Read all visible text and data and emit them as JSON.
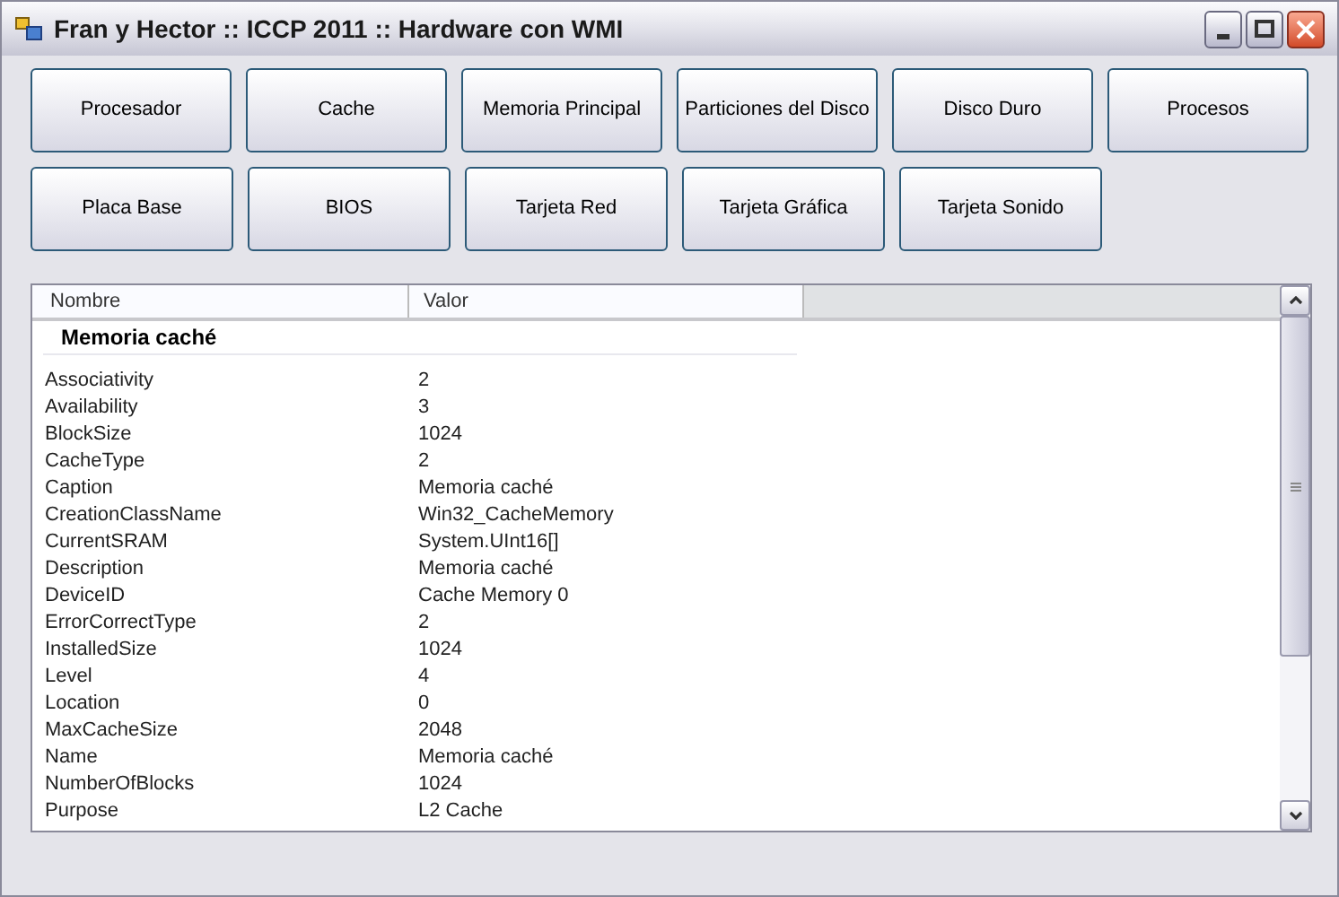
{
  "window": {
    "title": "Fran y Hector :: ICCP 2011 :: Hardware con WMI"
  },
  "button_rows": [
    [
      "Procesador",
      "Cache",
      "Memoria Principal",
      "Particiones del Disco",
      "Disco Duro",
      "Procesos"
    ],
    [
      "Placa Base",
      "BIOS",
      "Tarjeta Red",
      "Tarjeta Gráfica",
      "Tarjeta Sonido"
    ]
  ],
  "list": {
    "columns": [
      "Nombre",
      "Valor"
    ],
    "group": "Memoria caché",
    "rows": [
      {
        "name": "Associativity",
        "value": "2"
      },
      {
        "name": "Availability",
        "value": "3"
      },
      {
        "name": "BlockSize",
        "value": "1024"
      },
      {
        "name": "CacheType",
        "value": "2"
      },
      {
        "name": "Caption",
        "value": "Memoria caché"
      },
      {
        "name": "CreationClassName",
        "value": "Win32_CacheMemory"
      },
      {
        "name": "CurrentSRAM",
        "value": "System.UInt16[]"
      },
      {
        "name": "Description",
        "value": "Memoria caché"
      },
      {
        "name": "DeviceID",
        "value": "Cache Memory 0"
      },
      {
        "name": "ErrorCorrectType",
        "value": "2"
      },
      {
        "name": "InstalledSize",
        "value": "1024"
      },
      {
        "name": "Level",
        "value": "4"
      },
      {
        "name": "Location",
        "value": "0"
      },
      {
        "name": "MaxCacheSize",
        "value": "2048"
      },
      {
        "name": "Name",
        "value": "Memoria caché"
      },
      {
        "name": "NumberOfBlocks",
        "value": "1024"
      },
      {
        "name": "Purpose",
        "value": "L2 Cache"
      }
    ]
  }
}
